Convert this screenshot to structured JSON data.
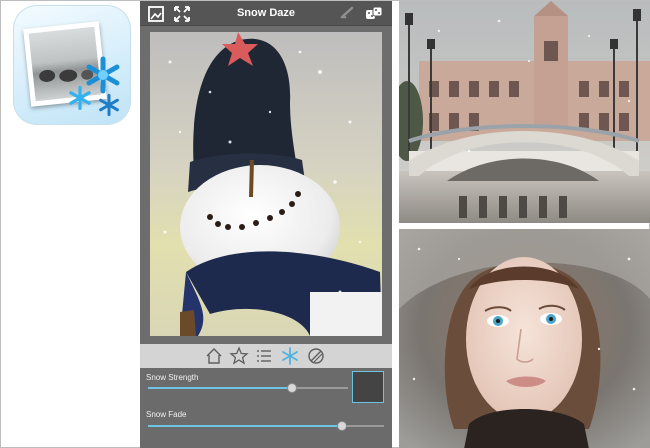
{
  "app": {
    "title": "Snow Daze"
  },
  "toolbar": {
    "items": [
      {
        "icon": "home-icon"
      },
      {
        "icon": "star-icon"
      },
      {
        "icon": "list-icon"
      },
      {
        "icon": "snowflake-icon"
      },
      {
        "icon": "no-filter-icon"
      }
    ]
  },
  "controls": {
    "strength_label": "Snow Strength",
    "strength_value": 0.72,
    "fade_label": "Snow Fade",
    "fade_value": 0.82
  },
  "colors": {
    "accent": "#6ec4e4",
    "topbar": "#555555",
    "panel": "#6b6b6b",
    "toolbar": "#d4d4d4"
  }
}
